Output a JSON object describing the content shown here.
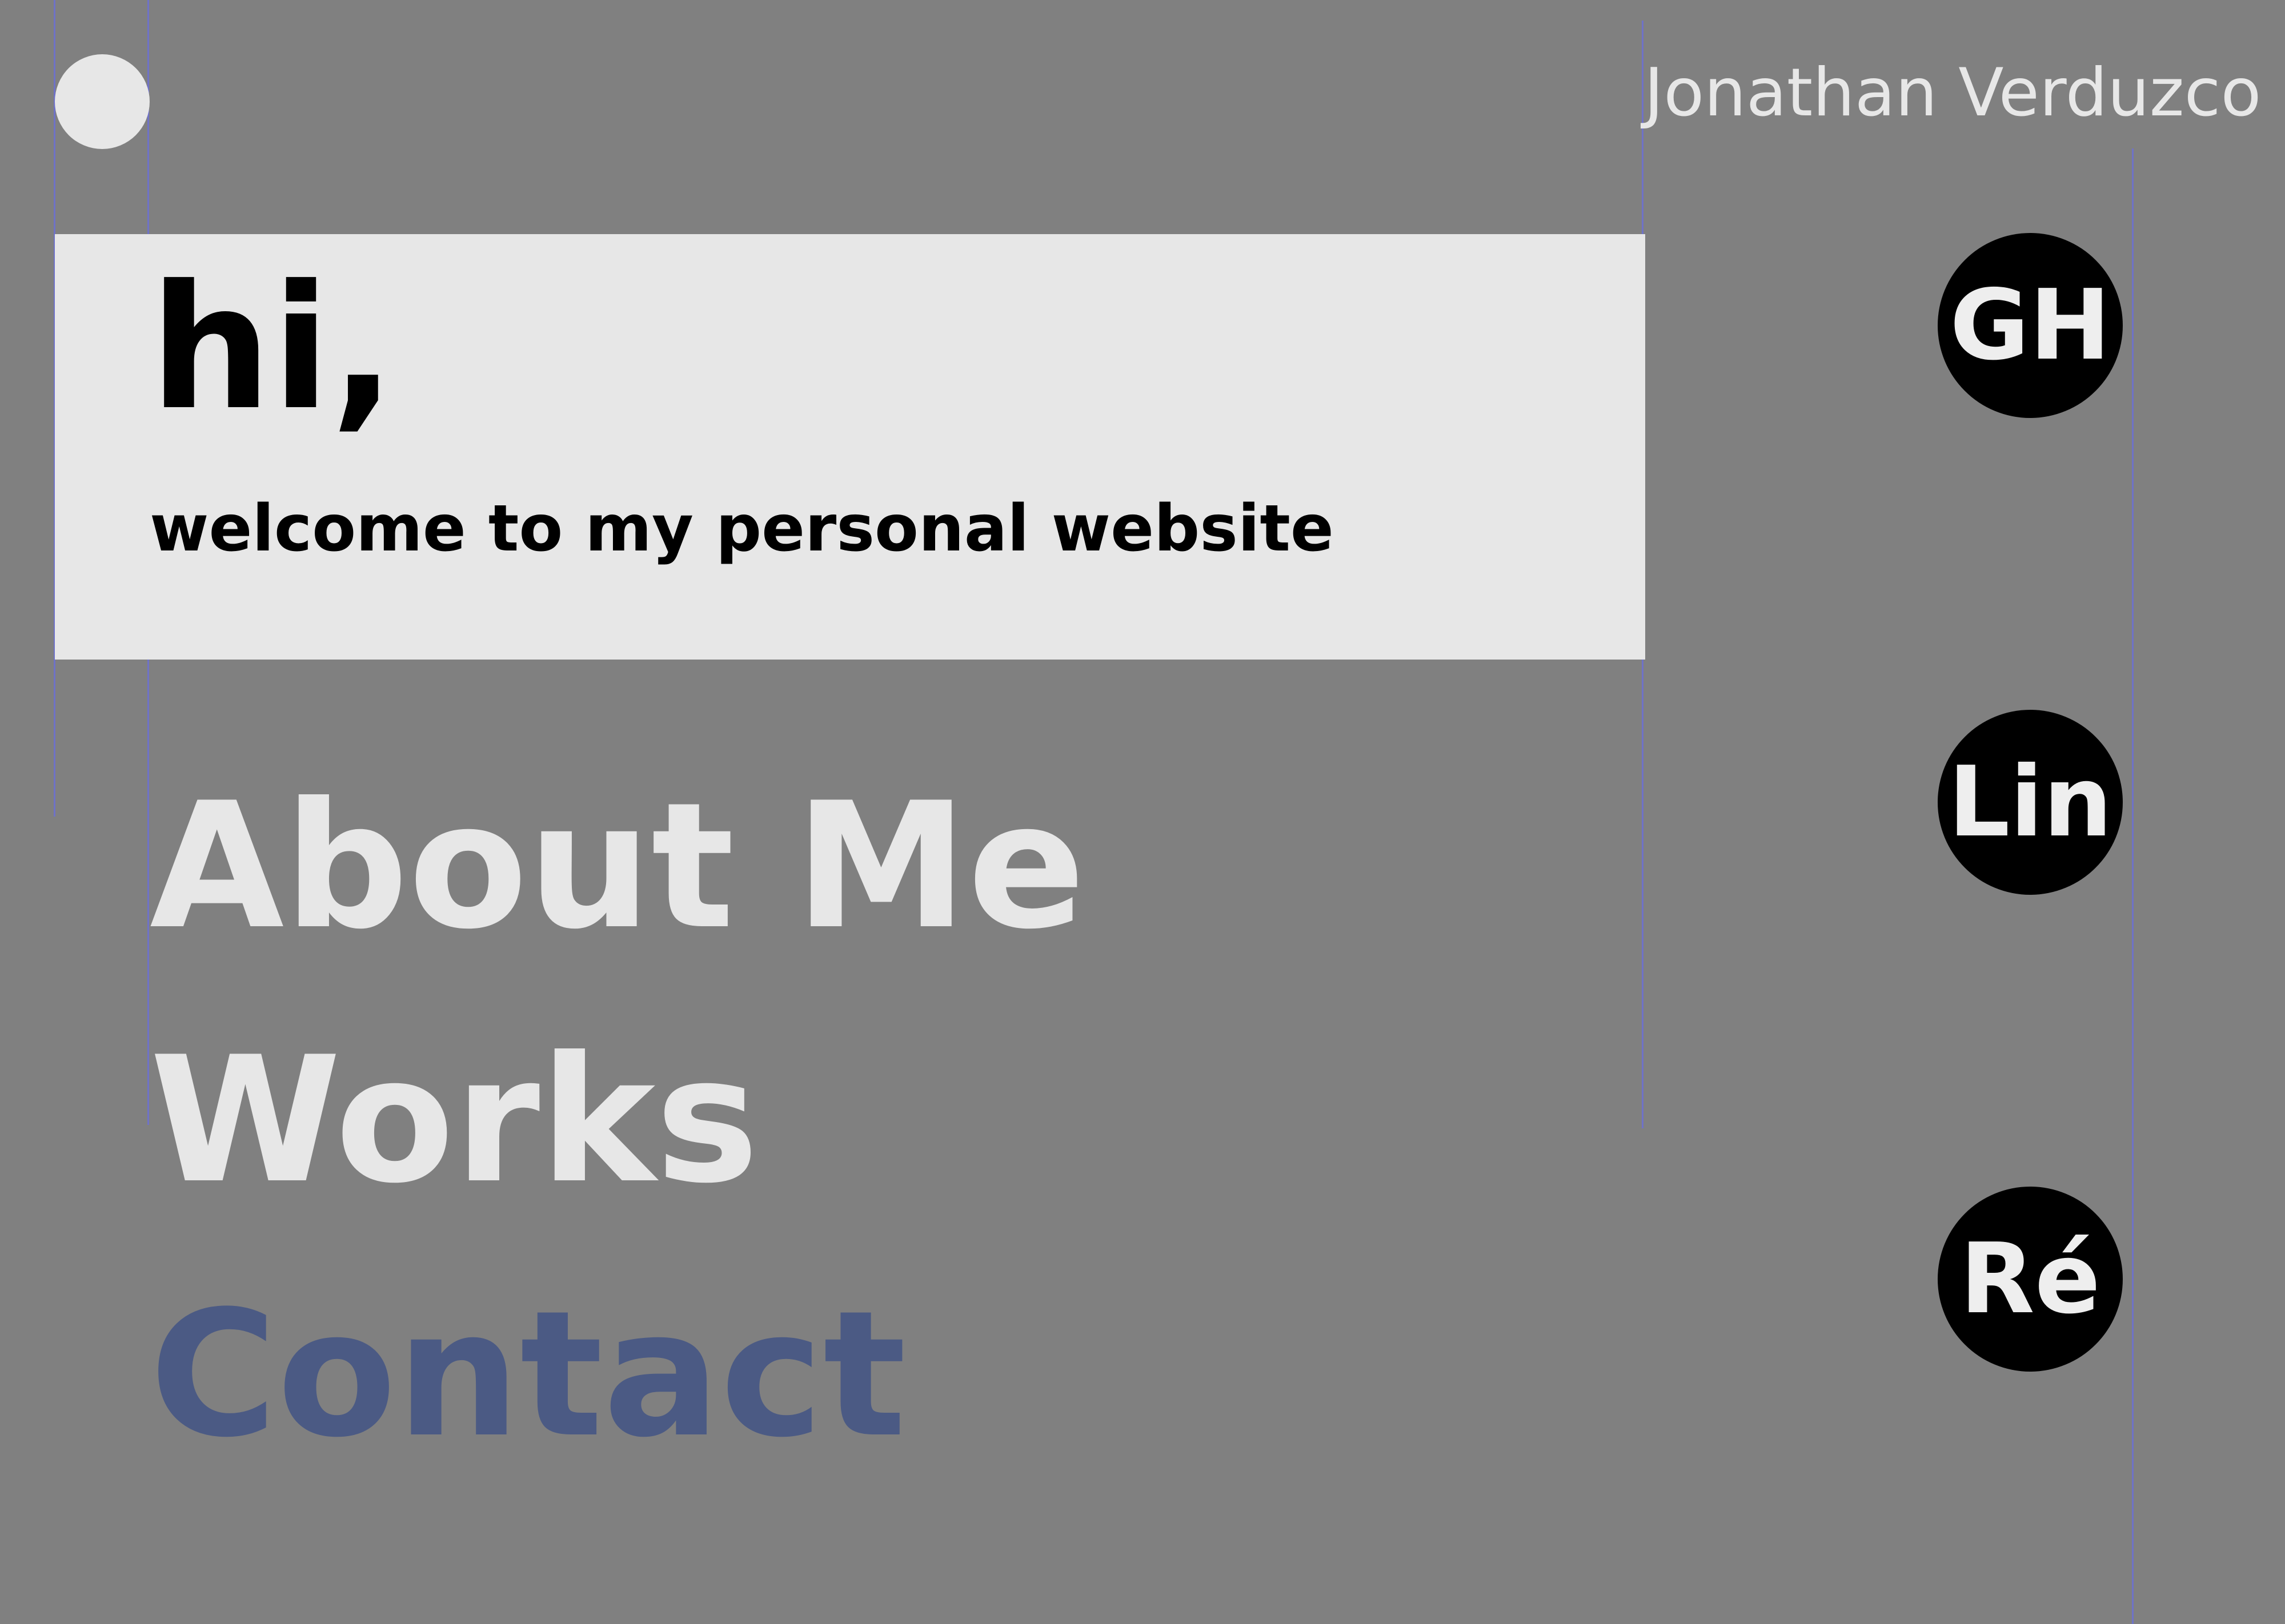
{
  "header": {
    "author_name": "Jonathan Verduzco"
  },
  "hero": {
    "title": "hi,",
    "subtitle": "welcome to my personal website"
  },
  "nav": {
    "items": [
      {
        "label": "About Me",
        "active": false
      },
      {
        "label": "Works",
        "active": false
      },
      {
        "label": "Contact",
        "active": true
      }
    ]
  },
  "social": {
    "items": [
      {
        "label": "GH"
      },
      {
        "label": "Lin"
      },
      {
        "label": "Ré"
      }
    ]
  },
  "colors": {
    "background": "#808080",
    "panel": "#e7e7e7",
    "text_light": "#e7e7e7",
    "text_dark": "#000000",
    "active_link": "#4b5a84",
    "guide_lines": "#6f72c7",
    "social_circle": "#000000"
  }
}
